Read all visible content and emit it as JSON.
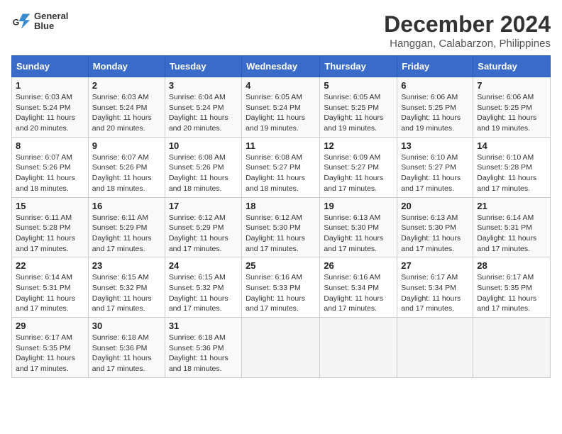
{
  "header": {
    "logo_line1": "General",
    "logo_line2": "Blue",
    "title": "December 2024",
    "subtitle": "Hanggan, Calabarzon, Philippines"
  },
  "calendar": {
    "days_of_week": [
      "Sunday",
      "Monday",
      "Tuesday",
      "Wednesday",
      "Thursday",
      "Friday",
      "Saturday"
    ],
    "weeks": [
      [
        {
          "day": "1",
          "sunrise": "6:03 AM",
          "sunset": "5:24 PM",
          "daylight": "11 hours and 20 minutes."
        },
        {
          "day": "2",
          "sunrise": "6:03 AM",
          "sunset": "5:24 PM",
          "daylight": "11 hours and 20 minutes."
        },
        {
          "day": "3",
          "sunrise": "6:04 AM",
          "sunset": "5:24 PM",
          "daylight": "11 hours and 20 minutes."
        },
        {
          "day": "4",
          "sunrise": "6:05 AM",
          "sunset": "5:24 PM",
          "daylight": "11 hours and 19 minutes."
        },
        {
          "day": "5",
          "sunrise": "6:05 AM",
          "sunset": "5:25 PM",
          "daylight": "11 hours and 19 minutes."
        },
        {
          "day": "6",
          "sunrise": "6:06 AM",
          "sunset": "5:25 PM",
          "daylight": "11 hours and 19 minutes."
        },
        {
          "day": "7",
          "sunrise": "6:06 AM",
          "sunset": "5:25 PM",
          "daylight": "11 hours and 19 minutes."
        }
      ],
      [
        {
          "day": "8",
          "sunrise": "6:07 AM",
          "sunset": "5:26 PM",
          "daylight": "11 hours and 18 minutes."
        },
        {
          "day": "9",
          "sunrise": "6:07 AM",
          "sunset": "5:26 PM",
          "daylight": "11 hours and 18 minutes."
        },
        {
          "day": "10",
          "sunrise": "6:08 AM",
          "sunset": "5:26 PM",
          "daylight": "11 hours and 18 minutes."
        },
        {
          "day": "11",
          "sunrise": "6:08 AM",
          "sunset": "5:27 PM",
          "daylight": "11 hours and 18 minutes."
        },
        {
          "day": "12",
          "sunrise": "6:09 AM",
          "sunset": "5:27 PM",
          "daylight": "11 hours and 17 minutes."
        },
        {
          "day": "13",
          "sunrise": "6:10 AM",
          "sunset": "5:27 PM",
          "daylight": "11 hours and 17 minutes."
        },
        {
          "day": "14",
          "sunrise": "6:10 AM",
          "sunset": "5:28 PM",
          "daylight": "11 hours and 17 minutes."
        }
      ],
      [
        {
          "day": "15",
          "sunrise": "6:11 AM",
          "sunset": "5:28 PM",
          "daylight": "11 hours and 17 minutes."
        },
        {
          "day": "16",
          "sunrise": "6:11 AM",
          "sunset": "5:29 PM",
          "daylight": "11 hours and 17 minutes."
        },
        {
          "day": "17",
          "sunrise": "6:12 AM",
          "sunset": "5:29 PM",
          "daylight": "11 hours and 17 minutes."
        },
        {
          "day": "18",
          "sunrise": "6:12 AM",
          "sunset": "5:30 PM",
          "daylight": "11 hours and 17 minutes."
        },
        {
          "day": "19",
          "sunrise": "6:13 AM",
          "sunset": "5:30 PM",
          "daylight": "11 hours and 17 minutes."
        },
        {
          "day": "20",
          "sunrise": "6:13 AM",
          "sunset": "5:30 PM",
          "daylight": "11 hours and 17 minutes."
        },
        {
          "day": "21",
          "sunrise": "6:14 AM",
          "sunset": "5:31 PM",
          "daylight": "11 hours and 17 minutes."
        }
      ],
      [
        {
          "day": "22",
          "sunrise": "6:14 AM",
          "sunset": "5:31 PM",
          "daylight": "11 hours and 17 minutes."
        },
        {
          "day": "23",
          "sunrise": "6:15 AM",
          "sunset": "5:32 PM",
          "daylight": "11 hours and 17 minutes."
        },
        {
          "day": "24",
          "sunrise": "6:15 AM",
          "sunset": "5:32 PM",
          "daylight": "11 hours and 17 minutes."
        },
        {
          "day": "25",
          "sunrise": "6:16 AM",
          "sunset": "5:33 PM",
          "daylight": "11 hours and 17 minutes."
        },
        {
          "day": "26",
          "sunrise": "6:16 AM",
          "sunset": "5:34 PM",
          "daylight": "11 hours and 17 minutes."
        },
        {
          "day": "27",
          "sunrise": "6:17 AM",
          "sunset": "5:34 PM",
          "daylight": "11 hours and 17 minutes."
        },
        {
          "day": "28",
          "sunrise": "6:17 AM",
          "sunset": "5:35 PM",
          "daylight": "11 hours and 17 minutes."
        }
      ],
      [
        {
          "day": "29",
          "sunrise": "6:17 AM",
          "sunset": "5:35 PM",
          "daylight": "11 hours and 17 minutes."
        },
        {
          "day": "30",
          "sunrise": "6:18 AM",
          "sunset": "5:36 PM",
          "daylight": "11 hours and 17 minutes."
        },
        {
          "day": "31",
          "sunrise": "6:18 AM",
          "sunset": "5:36 PM",
          "daylight": "11 hours and 18 minutes."
        },
        null,
        null,
        null,
        null
      ]
    ]
  }
}
